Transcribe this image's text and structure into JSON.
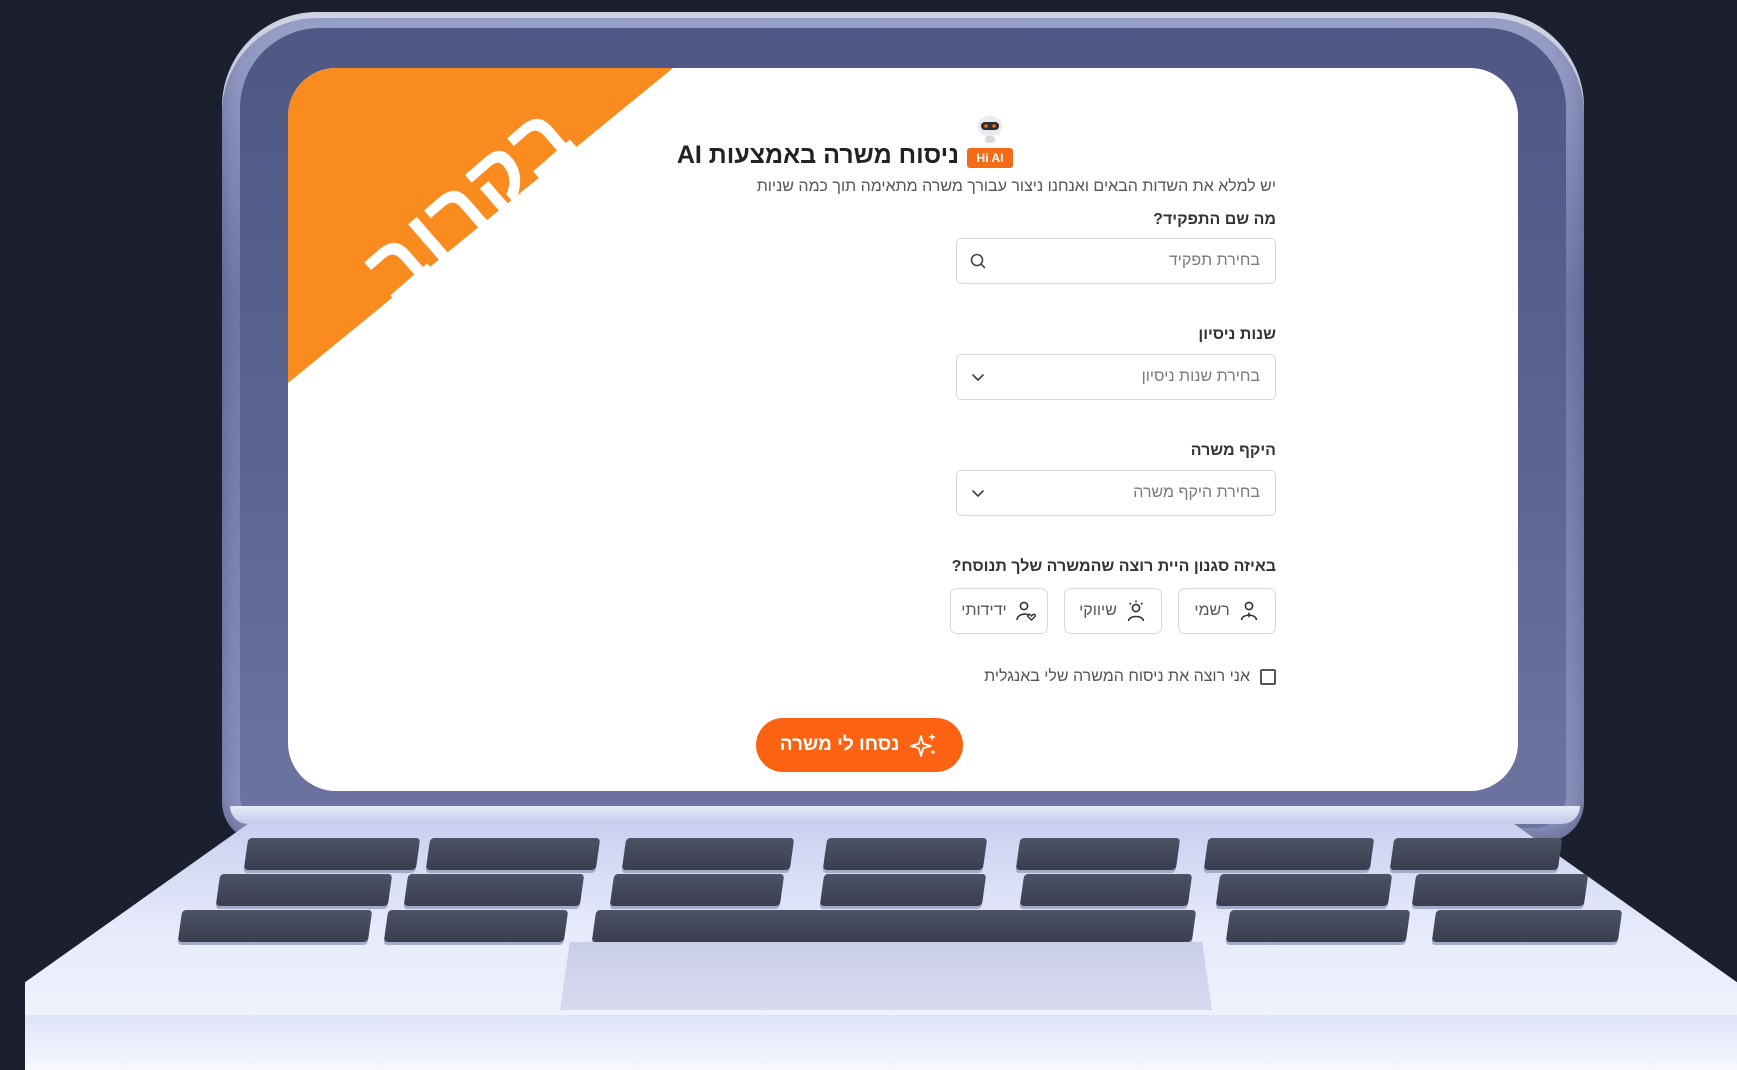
{
  "ribbon": {
    "text": "בקרוב"
  },
  "brand": {
    "badge": "Hi AI"
  },
  "form": {
    "title": "ניסוח משרה באמצעות AI",
    "intro": "יש למלא את השדות הבאים ואנחנו ניצור עבורך משרה מתאימה תוך כמה שניות",
    "role": {
      "label": "מה שם התפקיד?",
      "placeholder": "בחירת תפקיד"
    },
    "experience": {
      "label": "שנות ניסיון",
      "placeholder": "בחירת שנות ניסיון"
    },
    "scope": {
      "label": "היקף משרה",
      "placeholder": "בחירת היקף משרה"
    },
    "style": {
      "label": "באיזה סגנון היית רוצה שהמשרה שלך תנוסח?",
      "options": [
        {
          "label": "רשמי",
          "icon": "person-formal-icon"
        },
        {
          "label": "שיווקי",
          "icon": "person-marketing-icon"
        },
        {
          "label": "ידידותי",
          "icon": "person-heart-icon"
        }
      ]
    },
    "english_checkbox": {
      "label": "אני רוצה את ניסוח המשרה שלי באנגלית",
      "checked": false
    },
    "submit": {
      "label": "נסחו לי משרה",
      "icon": "sparkles-icon"
    }
  },
  "colors": {
    "ribbon": "#fa8b1f",
    "cta": "#fb6312",
    "badge": "#f36b16",
    "background": "#1b1f2e"
  }
}
